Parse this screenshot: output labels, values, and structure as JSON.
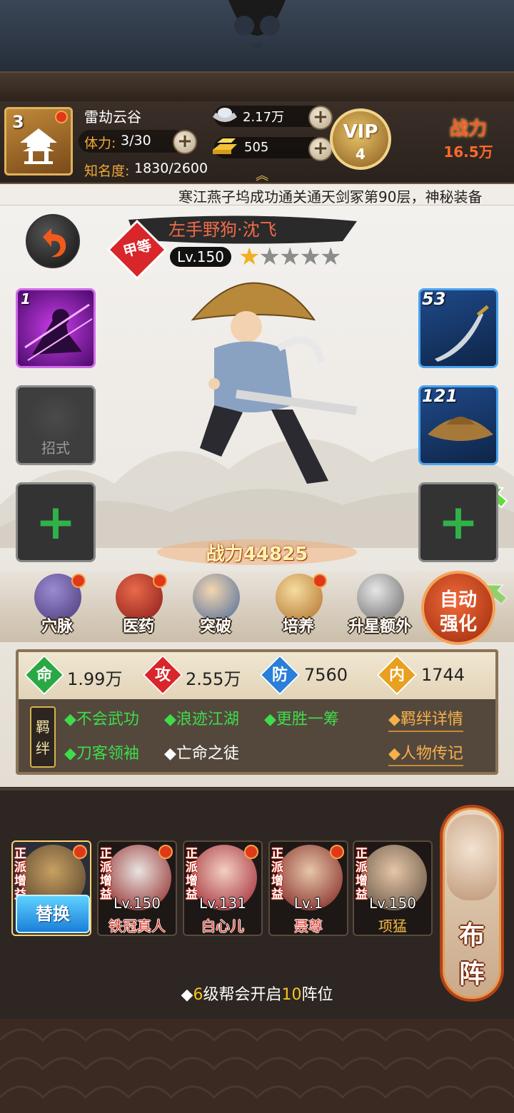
{
  "player": {
    "level": "3",
    "name": "雷劫云谷",
    "stamina_label": "体力:",
    "stamina_value": "3/30",
    "fame_label": "知名度:",
    "fame_value": "1830/2600"
  },
  "resources": {
    "silver": "2.17万",
    "gold": "505"
  },
  "vip": {
    "label": "VIP",
    "level": "4"
  },
  "top_power": {
    "label": "战力",
    "value": "16.5万"
  },
  "marquee": "寒江燕子坞成功通关通天剑冢第90层，神秘装备",
  "hero": {
    "grade": "甲等",
    "name": "左手野狗·沈飞",
    "level": "Lv.150",
    "stars_filled": 1,
    "stars_total": 5
  },
  "slots": {
    "skill_level": "1",
    "move_label": "招式",
    "weapon_level": "53",
    "hat_level": "121"
  },
  "hero_power": "战力44825",
  "functions": [
    {
      "label": "穴脉",
      "icon": "meridian-icon"
    },
    {
      "label": "医药",
      "icon": "medicine-icon"
    },
    {
      "label": "突破",
      "icon": "breakthrough-icon"
    },
    {
      "label": "培养",
      "icon": "cultivate-icon"
    },
    {
      "label": "升星额外",
      "icon": "star-up-icon"
    }
  ],
  "auto_enhance": {
    "line1": "自动",
    "line2": "强化"
  },
  "stats": [
    {
      "char": "命",
      "value": "1.99万",
      "color": "#2aa844"
    },
    {
      "char": "攻",
      "value": "2.55万",
      "color": "#d8262a"
    },
    {
      "char": "防",
      "value": "7560",
      "color": "#2a7fd8"
    },
    {
      "char": "内",
      "value": "1744",
      "color": "#e8a020"
    }
  ],
  "bonds": {
    "tag": [
      "羁",
      "绊"
    ],
    "items": [
      {
        "text": "◆不会武功",
        "active": true
      },
      {
        "text": "◆浪迹江湖",
        "active": true
      },
      {
        "text": "◆更胜一筹",
        "active": true
      },
      {
        "text": "◆刀客领袖",
        "active": true
      },
      {
        "text": "◆亡命之徒",
        "active": false
      }
    ],
    "detail_link": "◆羁绊详情",
    "bio_link": "◆人物传记"
  },
  "team": {
    "swap_label": "替换",
    "faction_badge": "正派增益",
    "members": [
      {
        "level": "Lv.150",
        "name": "铁冠真人"
      },
      {
        "level": "Lv.131",
        "name": "白心儿"
      },
      {
        "level": "Lv.1",
        "name": "聂尊"
      },
      {
        "level": "Lv.150",
        "name": "项猛"
      }
    ],
    "formation_line1": "布",
    "formation_line2": "阵",
    "guild_note_prefix": "◆",
    "guild_note_num1": "6",
    "guild_note_mid": "级帮会开启",
    "guild_note_num2": "10",
    "guild_note_suffix": "阵位"
  }
}
